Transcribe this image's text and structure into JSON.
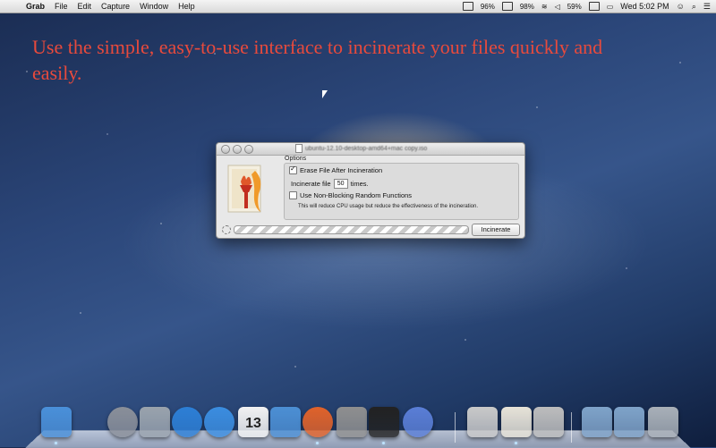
{
  "menubar": {
    "apple_icon": "apple-icon",
    "app_name": "Grab",
    "items": [
      "File",
      "Edit",
      "Capture",
      "Window",
      "Help"
    ],
    "status": {
      "battery_pct_1": "96%",
      "battery_pct_2": "98%",
      "battery_main": "59%",
      "clock": "Wed 5:02 PM"
    }
  },
  "headline": "Use the simple, easy-to-use interface to incinerate your files quickly and easily.",
  "window": {
    "title": "ubuntu-12.10-desktop-amd64+mac copy.iso",
    "options_label": "Options",
    "erase_label": "Erase File After Incineration",
    "erase_checked": true,
    "incinerate_prefix": "Incinerate file",
    "times_value": "50",
    "incinerate_suffix": "times.",
    "nonblocking_label": "Use Non-Blocking Random Functions",
    "nonblocking_checked": false,
    "note": "This will reduce CPU usage but reduce the effectiveness of the incineration.",
    "button_label": "Incinerate"
  },
  "dock": {
    "items": [
      {
        "name": "finder",
        "color": "#4a90d9"
      },
      {
        "name": "launchpad",
        "color": "#8a8f99"
      },
      {
        "name": "mission-control",
        "color": "#9aa3ad"
      },
      {
        "name": "app-store",
        "color": "#2d7fd6"
      },
      {
        "name": "safari",
        "color": "#3b8de0"
      },
      {
        "name": "calendar",
        "color": "#f2f2f2",
        "date": "13"
      },
      {
        "name": "xcode",
        "color": "#4c8fd4"
      },
      {
        "name": "cleaner",
        "color": "#e0622a"
      },
      {
        "name": "system-preferences",
        "color": "#8f8f8f"
      },
      {
        "name": "terminal",
        "color": "#222222"
      },
      {
        "name": "itunes",
        "color": "#5a7ed6"
      },
      {
        "name": "preview",
        "color": "#c9c9c9"
      },
      {
        "name": "incinerator",
        "color": "#e7e3d8"
      },
      {
        "name": "automator",
        "color": "#bdbdbd"
      },
      {
        "name": "folder-applications",
        "color": "#7fa3c9"
      },
      {
        "name": "folder-downloads",
        "color": "#7fa3c9"
      },
      {
        "name": "trash",
        "color": "#a9b0b8"
      }
    ]
  }
}
